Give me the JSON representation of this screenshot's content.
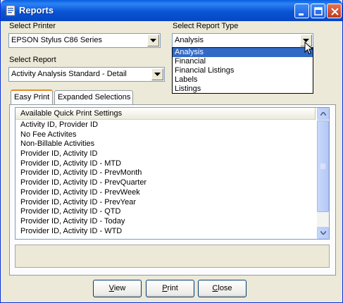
{
  "window": {
    "title": "Reports"
  },
  "printer": {
    "label": "Select Printer",
    "value": "EPSON Stylus C86 Series"
  },
  "report_type": {
    "label": "Select Report Type",
    "value": "Analysis",
    "options": [
      "Analysis",
      "Financial",
      "Financial Listings",
      "Labels",
      "Listings"
    ],
    "selected": "Analysis"
  },
  "report": {
    "label": "Select Report",
    "value": "Activity Analysis Standard - Detail"
  },
  "tabs": [
    {
      "label": "Easy Print"
    },
    {
      "label": "Expanded Selections"
    }
  ],
  "quick_print": {
    "header": "Available Quick Print Settings",
    "items": [
      "Activity ID, Provider ID",
      "No Fee Activites",
      "Non-Billable Activities",
      "Provider ID, Activity ID",
      "Provider ID, Activity ID - MTD",
      "Provider ID, Activity ID - PrevMonth",
      "Provider ID, Activity ID - PrevQuarter",
      "Provider ID, Activity ID - PrevWeek",
      "Provider ID, Activity ID - PrevYear",
      "Provider ID, Activity ID - QTD",
      "Provider ID, Activity ID - Today",
      "Provider ID, Activity ID - WTD"
    ]
  },
  "buttons": {
    "view": {
      "label_rest": "iew",
      "mnemonic": "V"
    },
    "print": {
      "label_rest": "rint",
      "mnemonic": "P"
    },
    "close": {
      "label_rest": "lose",
      "mnemonic": "C"
    }
  },
  "colors": {
    "selection": "#316ac5",
    "titlebar": "#0a54d4",
    "tab_highlight": "#e68b2c"
  }
}
